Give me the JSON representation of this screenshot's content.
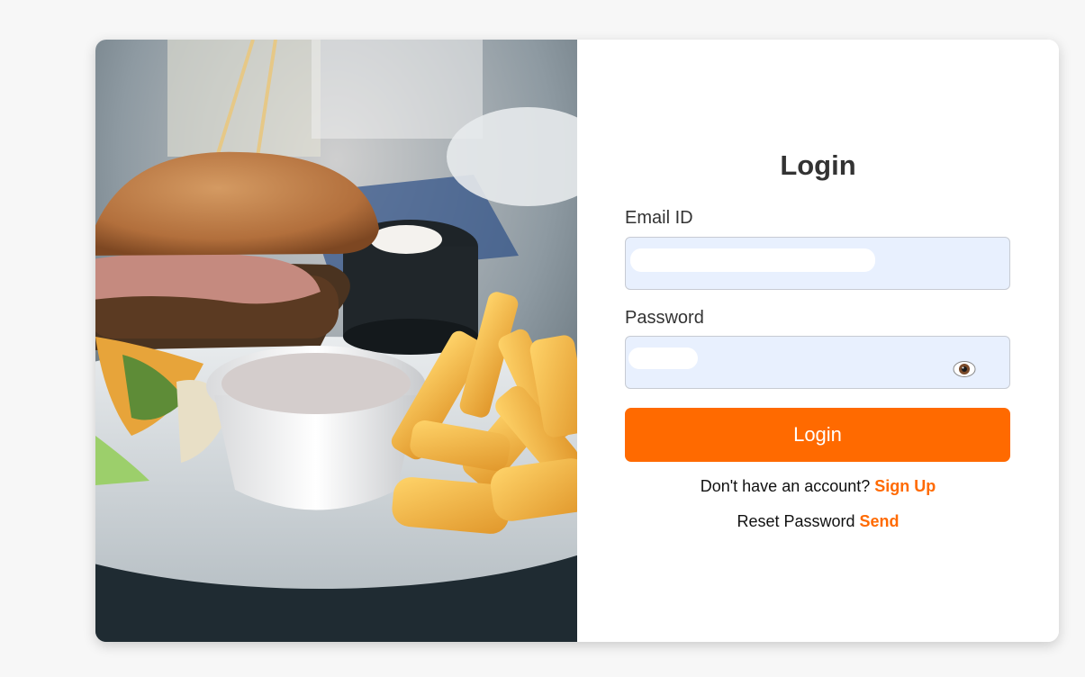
{
  "form": {
    "title": "Login",
    "email_label": "Email ID",
    "email_value": "",
    "password_label": "Password",
    "password_value": "",
    "login_button": "Login"
  },
  "footer": {
    "signup_prompt": "Don't have an account?",
    "signup_link": "Sign Up",
    "reset_prompt": "Reset Password",
    "reset_link": "Send"
  },
  "colors": {
    "accent": "#ff6a00",
    "input_bg": "#e8f0fe",
    "page_bg": "#f7f7f7"
  },
  "icons": {
    "password_toggle": "eye-icon"
  },
  "image": {
    "subject": "burger and fries on a plate"
  }
}
